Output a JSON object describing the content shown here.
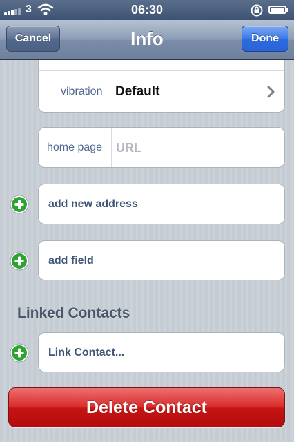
{
  "status_bar": {
    "carrier": "3",
    "time": "06:30"
  },
  "nav_bar": {
    "title": "Info",
    "cancel_label": "Cancel",
    "done_label": "Done"
  },
  "vibration_row": {
    "label": "vibration",
    "value": "Default"
  },
  "home_page_row": {
    "label": "home page",
    "placeholder": "URL"
  },
  "add_address_label": "add new address",
  "add_field_label": "add field",
  "linked_contacts": {
    "header": "Linked Contacts",
    "link_label": "Link Contact..."
  },
  "delete_label": "Delete Contact",
  "colors": {
    "accent_blue": "#2d6be0",
    "delete_red": "#c51414",
    "add_green": "#2fa332",
    "label_blue": "#50698f"
  }
}
